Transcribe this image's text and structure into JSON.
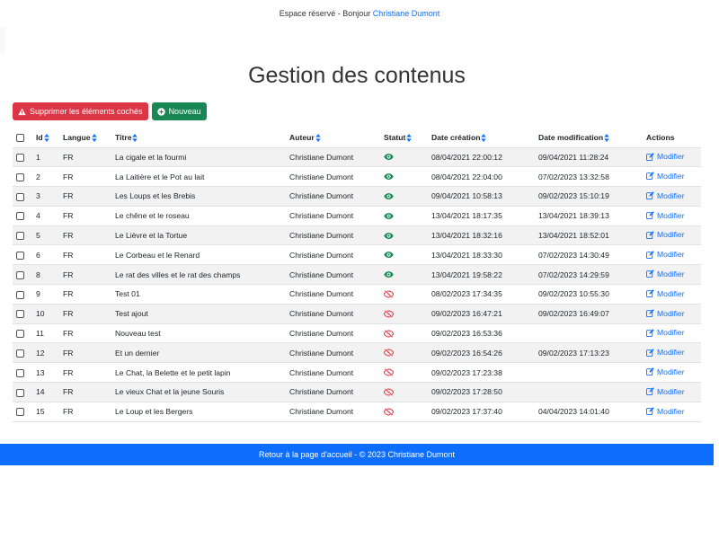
{
  "header": {
    "prefix": "Espace réservé - Bonjour ",
    "user_name": "Christiane Dumont"
  },
  "title": "Gestion des contenus",
  "buttons": {
    "delete_label": "Supprimer les éléments cochés",
    "new_label": "Nouveau"
  },
  "columns": {
    "id": "Id",
    "langue": "Langue",
    "titre": "Titre",
    "auteur": "Auteur",
    "statut": "Statut",
    "created": "Date création",
    "modified": "Date modification",
    "actions": "Actions"
  },
  "modify_label": "Modifier",
  "colors": {
    "primary": "#0d6efd",
    "danger": "#dc3545",
    "success": "#198754",
    "status_visible": "#198754",
    "status_hidden": "#dc3545"
  },
  "rows": [
    {
      "id": "1",
      "langue": "FR",
      "titre": "La cigale et la fourmi",
      "auteur": "Christiane Dumont",
      "status": "visible",
      "created": "08/04/2021 22:00:12",
      "modified": "09/04/2021 11:28:24"
    },
    {
      "id": "2",
      "langue": "FR",
      "titre": "La Laitière et le Pot au lait",
      "auteur": "Christiane Dumont",
      "status": "visible",
      "created": "08/04/2021 22:04:00",
      "modified": "07/02/2023 13:32:58"
    },
    {
      "id": "3",
      "langue": "FR",
      "titre": "Les Loups et les Brebis",
      "auteur": "Christiane Dumont",
      "status": "visible",
      "created": "09/04/2021 10:58:13",
      "modified": "09/02/2023 15:10:19"
    },
    {
      "id": "4",
      "langue": "FR",
      "titre": "Le chêne et le roseau",
      "auteur": "Christiane Dumont",
      "status": "visible",
      "created": "13/04/2021 18:17:35",
      "modified": "13/04/2021 18:39:13"
    },
    {
      "id": "5",
      "langue": "FR",
      "titre": "Le Lièvre et la Tortue",
      "auteur": "Christiane Dumont",
      "status": "visible",
      "created": "13/04/2021 18:32:16",
      "modified": "13/04/2021 18:52:01"
    },
    {
      "id": "6",
      "langue": "FR",
      "titre": "Le Corbeau et le Renard",
      "auteur": "Christiane Dumont",
      "status": "visible",
      "created": "13/04/2021 18:33:30",
      "modified": "07/02/2023 14:30:49"
    },
    {
      "id": "8",
      "langue": "FR",
      "titre": "Le rat des villes et le rat des champs",
      "auteur": "Christiane Dumont",
      "status": "visible",
      "created": "13/04/2021 19:58:22",
      "modified": "07/02/2023 14:29:59"
    },
    {
      "id": "9",
      "langue": "FR",
      "titre": "Test 01",
      "auteur": "Christiane Dumont",
      "status": "hidden",
      "created": "08/02/2023 17:34:35",
      "modified": "09/02/2023 10:55:30"
    },
    {
      "id": "10",
      "langue": "FR",
      "titre": "Test ajout",
      "auteur": "Christiane Dumont",
      "status": "hidden",
      "created": "09/02/2023 16:47:21",
      "modified": "09/02/2023 16:49:07"
    },
    {
      "id": "11",
      "langue": "FR",
      "titre": "Nouveau test",
      "auteur": "Christiane Dumont",
      "status": "hidden",
      "created": "09/02/2023 16:53:36",
      "modified": ""
    },
    {
      "id": "12",
      "langue": "FR",
      "titre": "Et un dernier",
      "auteur": "Christiane Dumont",
      "status": "hidden",
      "created": "09/02/2023 16:54:26",
      "modified": "09/02/2023 17:13:23"
    },
    {
      "id": "13",
      "langue": "FR",
      "titre": "Le Chat, la Belette et le petit lapin",
      "auteur": "Christiane Dumont",
      "status": "hidden",
      "created": "09/02/2023 17:23:38",
      "modified": ""
    },
    {
      "id": "14",
      "langue": "FR",
      "titre": "Le vieux Chat et la jeune Souris",
      "auteur": "Christiane Dumont",
      "status": "hidden",
      "created": "09/02/2023 17:28:50",
      "modified": ""
    },
    {
      "id": "15",
      "langue": "FR",
      "titre": "Le Loup et les Bergers",
      "auteur": "Christiane Dumont",
      "status": "hidden",
      "created": "09/02/2023 17:37:40",
      "modified": "04/04/2023 14:01:40"
    }
  ],
  "footer": {
    "link_label": "Retour à la page d'accueil",
    "copyright": " - © 2023 Christiane Dumont"
  }
}
